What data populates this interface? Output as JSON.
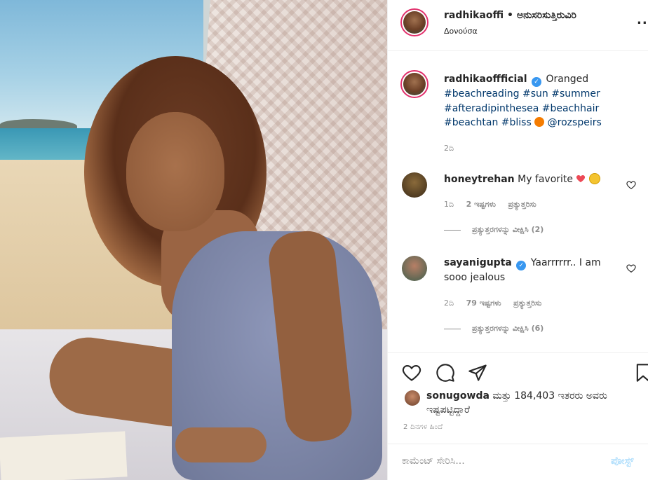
{
  "header": {
    "username": "radhikaoffi",
    "separator": "•",
    "follow_label": "ಅನುಸರಿಸುತ್ತಿರುವಿರಿ",
    "location": "Δονούσα",
    "more": "..."
  },
  "caption": {
    "username": "radhikaoffficial",
    "text_start": "Oranged",
    "hashtags_line1": "#beachreading #sun #summer",
    "hashtags_line2": "#afteradipinthesea #beachhair",
    "hashtags_line3": "#beachtan #bliss",
    "mention": "@rozspeirs",
    "time": "2ದಿ"
  },
  "comments": [
    {
      "username": "honeytrehan",
      "text": "My favorite",
      "time": "1ದಿ",
      "likes": "2 ಇಷ್ಟಗಳು",
      "reply": "ಪ್ರತ್ಯುತ್ತರಿಸು",
      "view_replies": "ಪ್ರತ್ಯುತ್ತರಗಳನ್ನು ವೀಕ್ಷಿಸಿ (2)"
    },
    {
      "username": "sayanigupta",
      "text": "Yaarrrrrr.. I am sooo jealous",
      "time": "2ದಿ",
      "likes": "79 ಇಷ್ಟಗಳು",
      "reply": "ಪ್ರತ್ಯುತ್ತರಿಸು",
      "view_replies": "ಪ್ರತ್ಯುತ್ತರಗಳನ್ನು ವೀಕ್ಷಿಸಿ (6)"
    }
  ],
  "likes": {
    "username": "sonugowda",
    "text": "ಮತ್ತು 184,403 ಇತರರು ಅವರು ಇಷ್ಟಪಟ್ಟಿದ್ದಾರೆ"
  },
  "posted_ago": "2 ದಿನಗಳ ಹಿಂದೆ",
  "add_comment": {
    "placeholder": "ಕಾಮೆಂಟ್ ಸೇರಿಸಿ...",
    "post_label": "ಪೋಸ್ಟ್"
  },
  "colors": {
    "verified": "#3897f0",
    "link": "#00376b",
    "post_disabled": "#b2dffc",
    "heart": "#ed4956"
  }
}
